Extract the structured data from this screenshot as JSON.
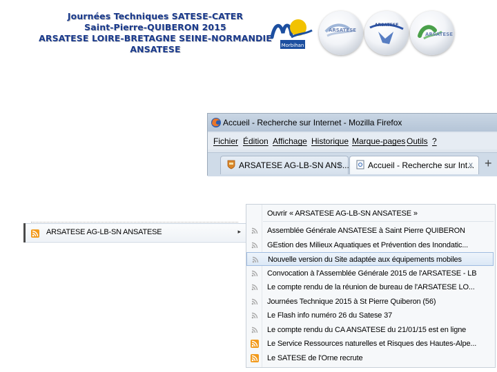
{
  "header": {
    "line1": "Journées Techniques SATESE-CATER",
    "line2": "Saint-Pierre-QUIBERON 2015",
    "line3": "ARSATESE LOIRE-BRETAGNE SEINE-NORMANDIE",
    "line4": "ANSATESE"
  },
  "logos": {
    "morbihan": "Morbihan",
    "arsatese1": "ARSATESE",
    "arsatese2": "ARSATESE",
    "arsatese3": "ARSATESE"
  },
  "browser": {
    "title": "Accueil - Recherche sur Internet - Mozilla Firefox",
    "menu": [
      "Fichier",
      "Édition",
      "Affichage",
      "Historique",
      "Marque-pages",
      "Outils",
      "?"
    ],
    "tabs": [
      {
        "label": "ARSATESE AG-LB-SN ANS...",
        "close": "x"
      },
      {
        "label": "Accueil - Recherche sur Int...",
        "close": "x"
      }
    ],
    "new_tab": "+"
  },
  "bookmark_folder": {
    "label": "ARSATESE AG-LB-SN ANSATESE",
    "arrow": "▸"
  },
  "feed_menu": {
    "open_all": "Ouvrir « ARSATESE AG-LB-SN ANSATESE »",
    "items": [
      {
        "label": "Assemblée Générale ANSATESE à Saint Pierre QUIBERON",
        "icon": "rss-grey-icon"
      },
      {
        "label": "GEstion des Milieux Aquatiques et Prévention des Inondatic...",
        "icon": "rss-grey-icon"
      },
      {
        "label": "Nouvelle version du Site adaptée aux équipements mobiles",
        "icon": "rss-grey-icon"
      },
      {
        "label": "Convocation à l'Assemblée Générale 2015 de l'ARSATESE - LB",
        "icon": "rss-grey-icon"
      },
      {
        "label": "Le compte rendu de la réunion de bureau de l'ARSATESE LO...",
        "icon": "rss-grey-icon"
      },
      {
        "label": "Journées Technique 2015 à St Pierre Quiberon (56)",
        "icon": "rss-grey-icon"
      },
      {
        "label": "Le Flash info numéro 26 du Satese 37",
        "icon": "rss-grey-icon"
      },
      {
        "label": "Le compte rendu du CA ANSATESE du 21/01/15 est en ligne",
        "icon": "rss-grey-icon"
      },
      {
        "label": "Le Service Ressources naturelles et Risques des Hautes-Alpe...",
        "icon": "rss-orange-icon"
      },
      {
        "label": "Le SATESE de l'Orne recrute",
        "icon": "rss-orange-icon"
      }
    ]
  },
  "colors": {
    "header_text": "#1a3a8c",
    "rss_orange": "#f29a1c",
    "rss_grey": "#a9a9a9",
    "highlight": "#dbe8f6"
  }
}
